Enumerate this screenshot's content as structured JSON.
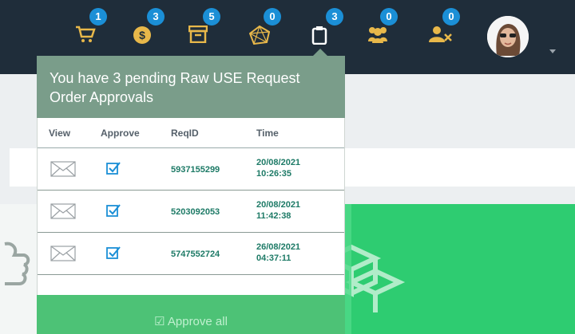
{
  "nav": {
    "icons": [
      {
        "name": "cart-icon",
        "badge": "1"
      },
      {
        "name": "coin-icon",
        "badge": "3"
      },
      {
        "name": "archive-icon",
        "badge": "5"
      },
      {
        "name": "network-icon",
        "badge": "0"
      },
      {
        "name": "clipboard-icon",
        "badge": "3"
      },
      {
        "name": "users-icon",
        "badge": "0"
      },
      {
        "name": "user-remove-icon",
        "badge": "0"
      }
    ]
  },
  "dropdown": {
    "title": "You have 3 pending Raw USE Request Order Approvals",
    "columns": [
      "View",
      "Approve",
      "ReqID",
      "Time"
    ],
    "rows": [
      {
        "reqid": "5937155299",
        "date": "20/08/2021",
        "time": "10:26:35"
      },
      {
        "reqid": "5203092053",
        "date": "20/08/2021",
        "time": "11:42:38"
      },
      {
        "reqid": "5747552724",
        "date": "26/08/2021",
        "time": "04:37:11"
      }
    ],
    "approve_all": "Approve all"
  },
  "colors": {
    "navbar": "#1f2d3a",
    "badge": "#1b8fd6",
    "header": "#7a9d8a",
    "green": "#2ecc71"
  }
}
